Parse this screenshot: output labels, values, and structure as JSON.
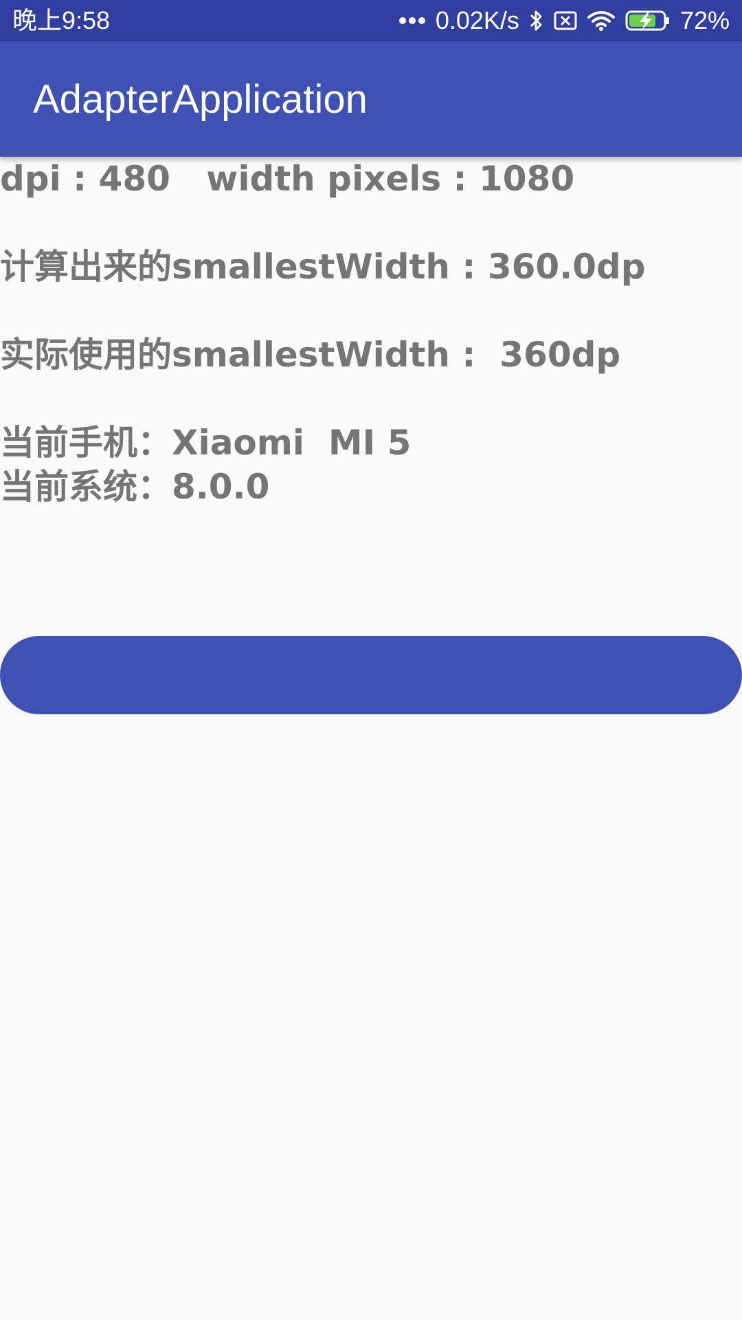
{
  "status_bar": {
    "time": "晚上9:58",
    "net_speed": "0.02K/s",
    "battery": "72%",
    "icons": [
      "more-dots-icon",
      "bluetooth-icon",
      "no-sim-icon",
      "wifi-icon",
      "battery-charging-icon"
    ]
  },
  "app_bar": {
    "title": "AdapterApplication"
  },
  "info": {
    "dpi_line": "dpi : 480   width pixels : 1080",
    "calculated_sw": "计算出来的smallestWidth : 360.0dp",
    "actual_sw": "实际使用的smallestWidth :  360dp",
    "phone": "当前手机：Xiaomi  MI 5",
    "system": "当前系统：8.0.0"
  },
  "button": {
    "label": ""
  },
  "colors": {
    "status_bar": "#303f9f",
    "primary": "#3f51b5",
    "text": "#757575",
    "background": "#fafafa"
  }
}
